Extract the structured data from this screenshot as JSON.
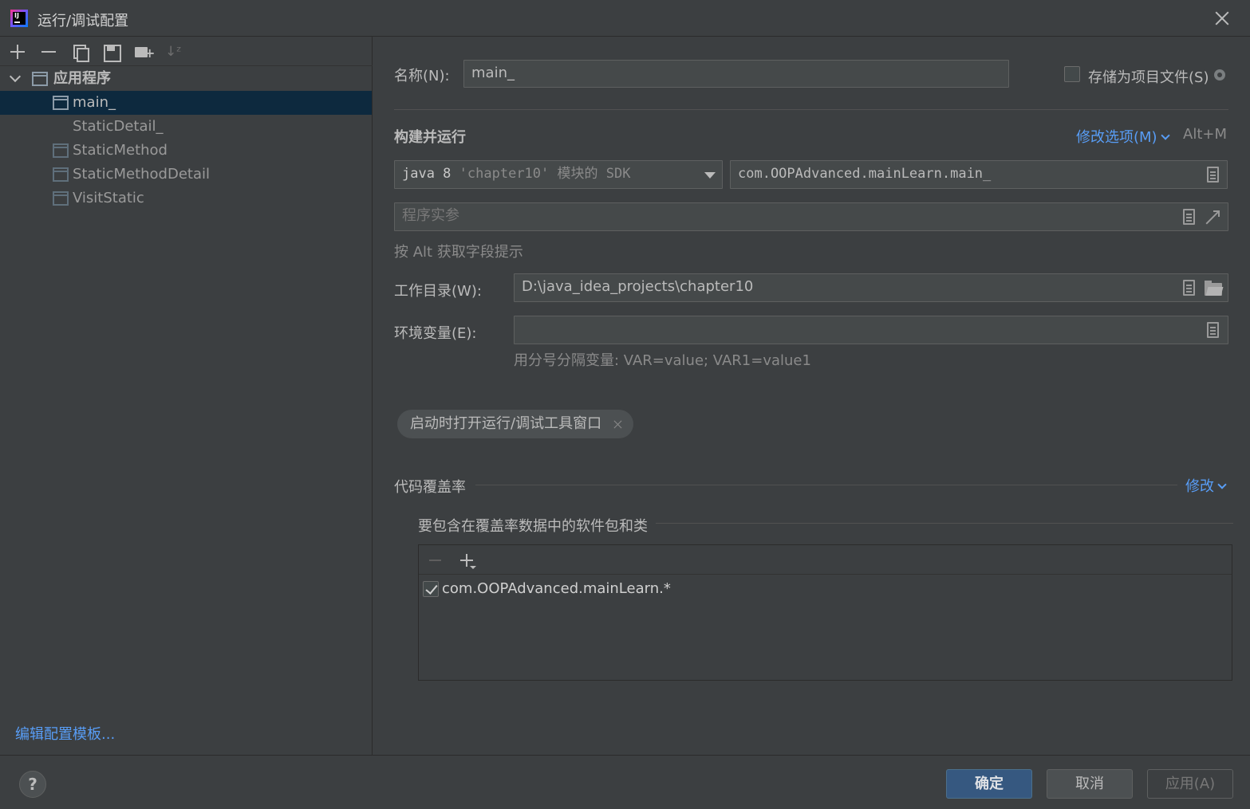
{
  "window": {
    "title": "运行/调试配置"
  },
  "tree": {
    "group_label": "应用程序",
    "items": [
      {
        "label": "main_"
      },
      {
        "label": "StaticDetail_"
      },
      {
        "label": "StaticMethod"
      },
      {
        "label": "StaticMethodDetail"
      },
      {
        "label": "VisitStatic"
      }
    ],
    "edit_templates": "编辑配置模板..."
  },
  "form": {
    "name_label": "名称(N):",
    "name_value": "main_",
    "store_as_project_file": "存储为项目文件(S)",
    "section_build_run": "构建并运行",
    "modify_options": "修改选项(M)",
    "modify_options_shortcut": "Alt+M",
    "sdk_java": "java 8",
    "sdk_module": "'chapter10'",
    "sdk_suffix": "模块的 SDK",
    "main_class": "com.OOPAdvanced.mainLearn.main_",
    "program_args_placeholder": "程序实参",
    "alt_hint": "按 Alt 获取字段提示",
    "workdir_label": "工作目录(W):",
    "workdir_value": "D:\\java_idea_projects\\chapter10",
    "env_label": "环境变量(E):",
    "env_value": "",
    "env_hint": "用分号分隔变量: VAR=value; VAR1=value1",
    "chip_open_tool_window": "启动时打开运行/调试工具窗口"
  },
  "coverage": {
    "section_label": "代码覆盖率",
    "modify_link": "修改",
    "include_label": "要包含在覆盖率数据中的软件包和类",
    "entries": [
      {
        "checked": true,
        "pattern": "com.OOPAdvanced.mainLearn.*"
      }
    ]
  },
  "footer": {
    "help": "?",
    "ok": "确定",
    "cancel": "取消",
    "apply": "应用(A)"
  },
  "colors": {
    "background": "#3c3f41",
    "selection": "#0d293e",
    "link": "#589df6",
    "primary_button": "#365880"
  }
}
